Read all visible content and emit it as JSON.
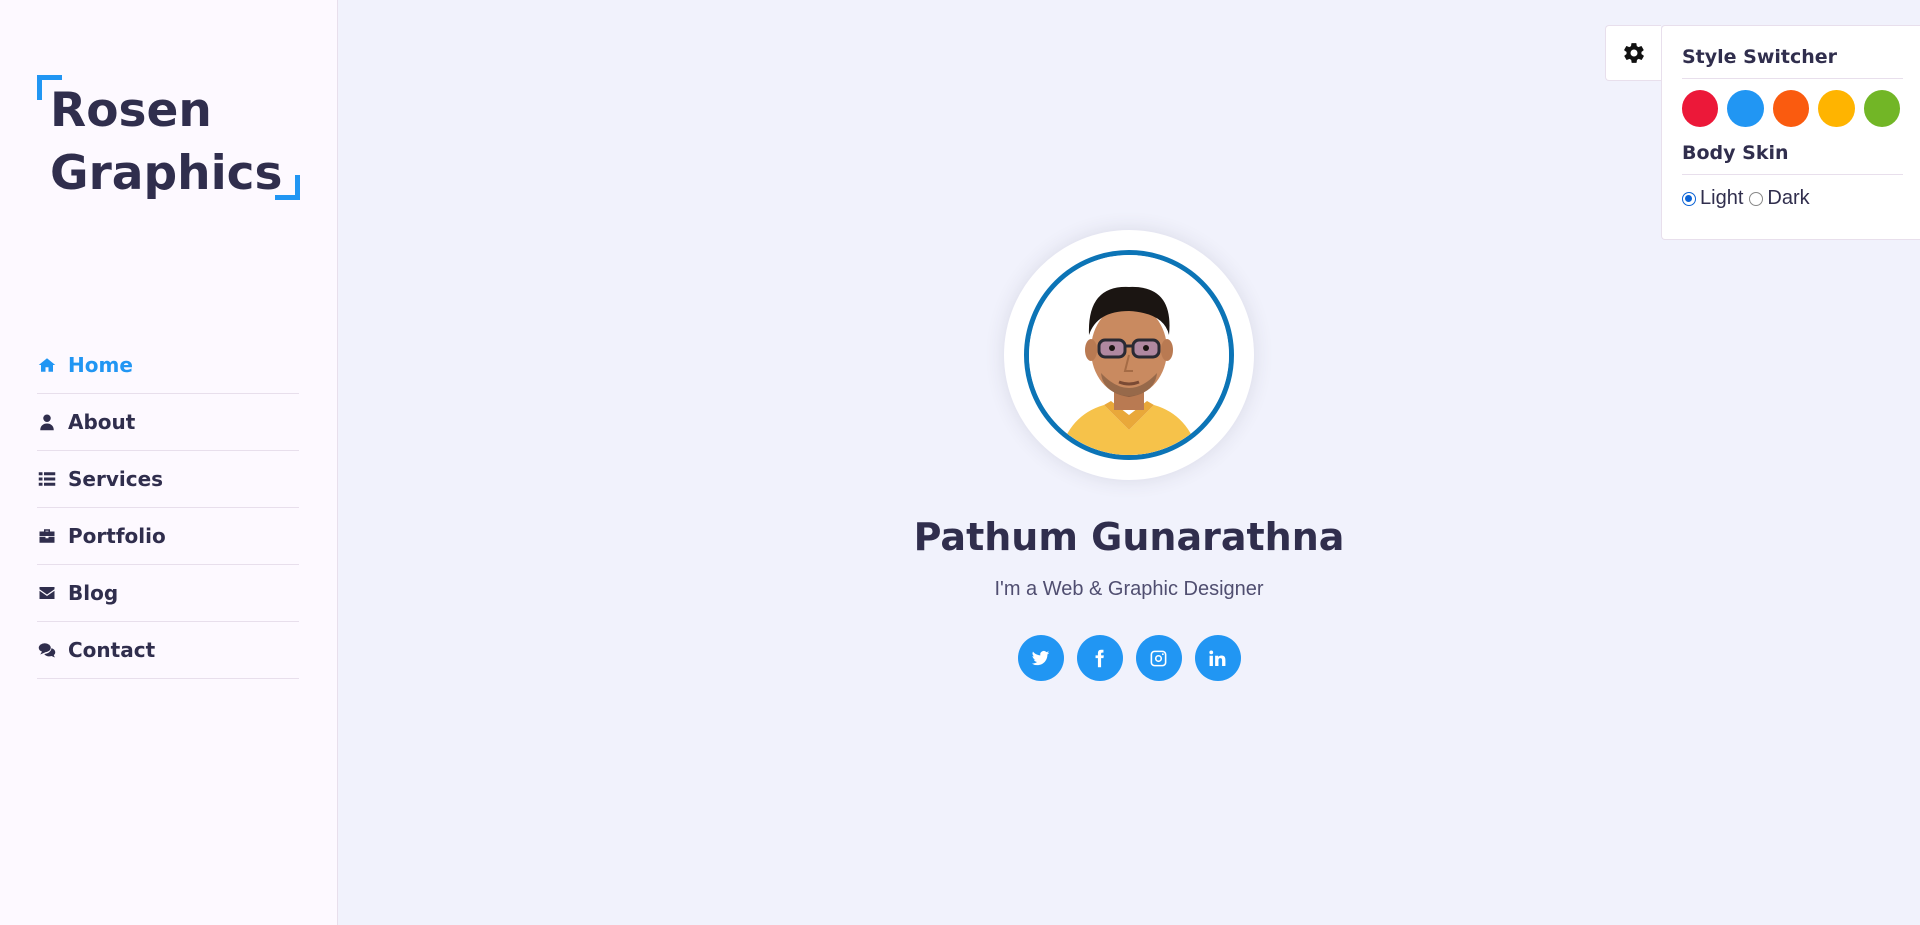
{
  "sidebar": {
    "logo": {
      "line1": "Rosen",
      "line2": "Graphics"
    },
    "nav": [
      {
        "label": "Home",
        "icon": "home-icon",
        "active": true
      },
      {
        "label": "About",
        "icon": "user-icon",
        "active": false
      },
      {
        "label": "Services",
        "icon": "list-icon",
        "active": false
      },
      {
        "label": "Portfolio",
        "icon": "briefcase-icon",
        "active": false
      },
      {
        "label": "Blog",
        "icon": "envelope-icon",
        "active": false
      },
      {
        "label": "Contact",
        "icon": "comments-icon",
        "active": false
      }
    ]
  },
  "home": {
    "name": "Pathum Gunarathna",
    "tagline": "I'm a Web & Graphic Designer",
    "socials": [
      {
        "icon": "twitter-icon"
      },
      {
        "icon": "facebook-icon"
      },
      {
        "icon": "instagram-icon"
      },
      {
        "icon": "linkedin-icon"
      }
    ]
  },
  "style_switcher": {
    "toggle_icon": "gear-icon",
    "title": "Style Switcher",
    "colors": [
      "#ec1839",
      "#2196f3",
      "#fa5b0f",
      "#ffb400",
      "#72b626"
    ],
    "skin_title": "Body Skin",
    "skin_options": [
      {
        "label": "Light",
        "checked": true
      },
      {
        "label": "Dark",
        "checked": false
      }
    ]
  },
  "theme": {
    "accent": "#2196f3",
    "text": "#302e4d",
    "background": "#f1f2fc",
    "sidebar_bg": "#fdf9ff"
  }
}
